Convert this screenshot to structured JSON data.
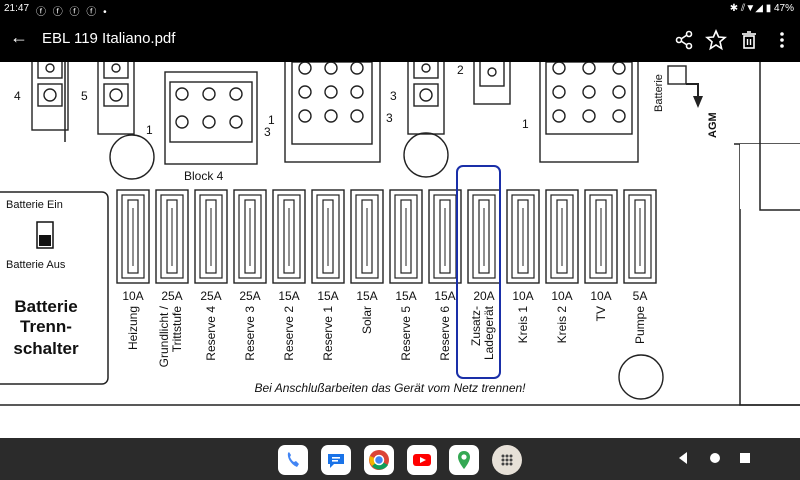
{
  "status": {
    "time": "21:47",
    "notif_icons": "ⓕ ⓕ ⓕ ⓕ •",
    "right": "✱ ⫽▼◢ ▮ 47%"
  },
  "app": {
    "title": "EBL 119 Italiano.pdf",
    "back_glyph": "←"
  },
  "diagram": {
    "labels": {
      "n4": "4",
      "n5": "5",
      "n1a": "1",
      "n13a": "1",
      "n13b": "3",
      "n3a": "3",
      "n3b": "3",
      "n2": "2",
      "n1b": "1",
      "batterie_rot": "Batterie",
      "agm": "AGM",
      "block4": "Block 4"
    },
    "switch": {
      "ein": "Batterie Ein",
      "aus": "Batterie Aus",
      "title1": "Batterie",
      "title2": "Trenn-",
      "title3": "schalter"
    },
    "fuses": [
      {
        "amp": "10A",
        "label1": "Heizung",
        "label2": ""
      },
      {
        "amp": "25A",
        "label1": "Grundlicht /",
        "label2": "Trittstufe"
      },
      {
        "amp": "25A",
        "label1": "Reserve 4",
        "label2": ""
      },
      {
        "amp": "25A",
        "label1": "Reserve 3",
        "label2": ""
      },
      {
        "amp": "15A",
        "label1": "Reserve 2",
        "label2": ""
      },
      {
        "amp": "15A",
        "label1": "Reserve 1",
        "label2": ""
      },
      {
        "amp": "15A",
        "label1": "Solar",
        "label2": ""
      },
      {
        "amp": "15A",
        "label1": "Reserve 5",
        "label2": ""
      },
      {
        "amp": "15A",
        "label1": "Reserve 6",
        "label2": ""
      },
      {
        "amp": "20A",
        "label1": "Zusatz-",
        "label2": "Ladegerät"
      },
      {
        "amp": "10A",
        "label1": "Kreis 1",
        "label2": ""
      },
      {
        "amp": "10A",
        "label1": "Kreis 2",
        "label2": ""
      },
      {
        "amp": "10A",
        "label1": "TV",
        "label2": ""
      },
      {
        "amp": "5A",
        "label1": "Pumpe",
        "label2": ""
      }
    ],
    "notice": "Bei Anschlußarbeiten das Gerät vom Netz trennen!"
  },
  "colors": {
    "highlight": "#1a2fa8",
    "dock_phone": "#4285f4",
    "dock_msg": "#1a73e8",
    "dock_yt": "#ff0000",
    "dock_maps": "#34a853"
  }
}
